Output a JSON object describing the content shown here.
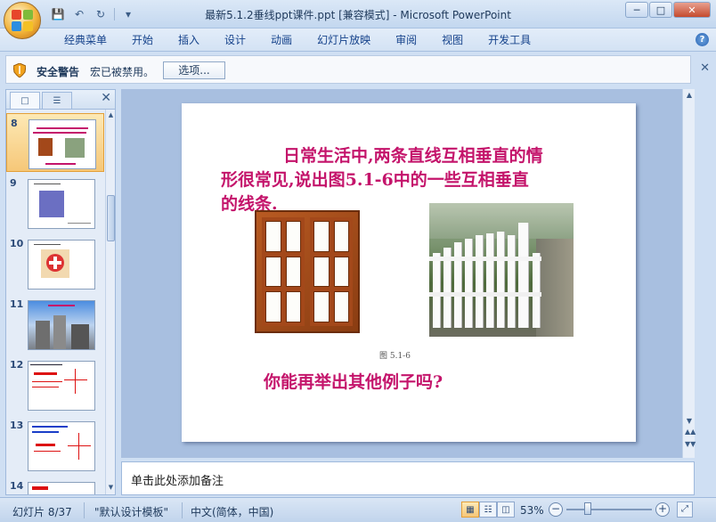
{
  "window": {
    "title": "最新5.1.2垂线ppt课件.ppt [兼容模式] - Microsoft PowerPoint",
    "minimize": "─",
    "maximize": "□",
    "close": "✕"
  },
  "quick_access": [
    "save-icon",
    "undo-icon",
    "redo-icon",
    "customize-icon"
  ],
  "ribbon": {
    "tabs": [
      "经典菜单",
      "开始",
      "插入",
      "设计",
      "动画",
      "幻灯片放映",
      "审阅",
      "视图",
      "开发工具"
    ],
    "help": "?"
  },
  "security_bar": {
    "title": "安全警告",
    "message": "宏已被禁用。",
    "options_label": "选项...",
    "close": "✕"
  },
  "thumbnail_pane": {
    "close": "✕",
    "slides": [
      {
        "number": "8",
        "selected": true
      },
      {
        "number": "9",
        "selected": false
      },
      {
        "number": "10",
        "selected": false
      },
      {
        "number": "11",
        "selected": false
      },
      {
        "number": "12",
        "selected": false
      },
      {
        "number": "13",
        "selected": false
      },
      {
        "number": "14",
        "selected": false
      }
    ]
  },
  "slide": {
    "text_line1": "日常生活中,两条直线互相垂直的情",
    "text_line2": "形很常见,说出图5.1-6中的一些互相垂直",
    "text_line3": "的线条.",
    "caption": "图 5.1-6",
    "question": "你能再举出其他例子吗?"
  },
  "notes": {
    "placeholder": "单击此处添加备注"
  },
  "status_bar": {
    "slide_info": "幻灯片 8/37",
    "template": "\"默认设计模板\"",
    "language": "中文(简体，中国)",
    "zoom": "53%",
    "zoom_out": "−",
    "zoom_in": "+"
  },
  "colors": {
    "slide_text": "#c4146b",
    "selected_thumb": "#f6c778"
  }
}
